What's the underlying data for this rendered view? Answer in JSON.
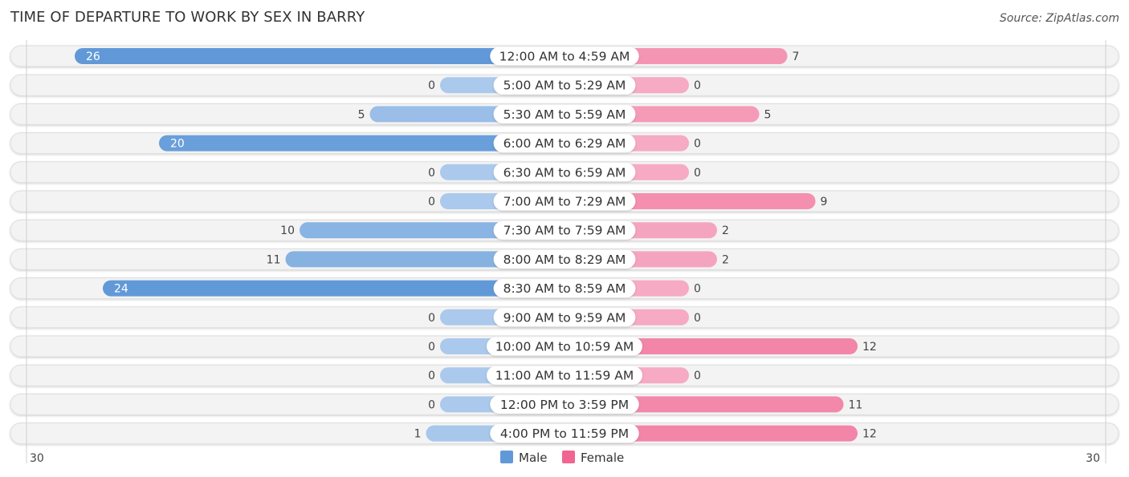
{
  "chart_data": {
    "type": "bar",
    "orientation": "horizontal-diverging",
    "title": "TIME OF DEPARTURE TO WORK BY SEX IN BARRY",
    "source": "Source: ZipAtlas.com",
    "categories": [
      "12:00 AM to 4:59 AM",
      "5:00 AM to 5:29 AM",
      "5:30 AM to 5:59 AM",
      "6:00 AM to 6:29 AM",
      "6:30 AM to 6:59 AM",
      "7:00 AM to 7:29 AM",
      "7:30 AM to 7:59 AM",
      "8:00 AM to 8:29 AM",
      "8:30 AM to 8:59 AM",
      "9:00 AM to 9:59 AM",
      "10:00 AM to 10:59 AM",
      "11:00 AM to 11:59 AM",
      "12:00 PM to 3:59 PM",
      "4:00 PM to 11:59 PM"
    ],
    "series": [
      {
        "name": "Male",
        "color": "#6199d8",
        "light_color": "#aac9ec",
        "values": [
          26,
          0,
          5,
          20,
          0,
          0,
          10,
          11,
          24,
          0,
          0,
          0,
          0,
          1
        ]
      },
      {
        "name": "Female",
        "color": "#f06592",
        "light_color": "#f6aac3",
        "values": [
          7,
          0,
          5,
          0,
          0,
          9,
          2,
          2,
          0,
          0,
          12,
          0,
          11,
          12
        ]
      }
    ],
    "axis": {
      "left_tick": "30",
      "right_tick": "30",
      "range": [
        0,
        30
      ]
    },
    "legend": {
      "position": "bottom-center",
      "entries": [
        "Male",
        "Female"
      ]
    },
    "grid": false
  }
}
